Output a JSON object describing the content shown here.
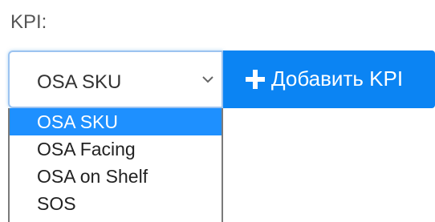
{
  "kpi_label": "KPI:",
  "select": {
    "value": "OSA SKU",
    "arrow_icon": "chevron-down-icon"
  },
  "add_button": {
    "label": "Добавить KPI",
    "icon": "plus-icon"
  },
  "dropdown": {
    "options": [
      {
        "label": "OSA SKU",
        "selected": true
      },
      {
        "label": "OSA Facing",
        "selected": false
      },
      {
        "label": "OSA on Shelf",
        "selected": false
      },
      {
        "label": "SOS",
        "selected": false
      }
    ]
  },
  "colors": {
    "accent": "#0b84f3",
    "highlight": "#1e90ff",
    "label_text": "#555555"
  }
}
